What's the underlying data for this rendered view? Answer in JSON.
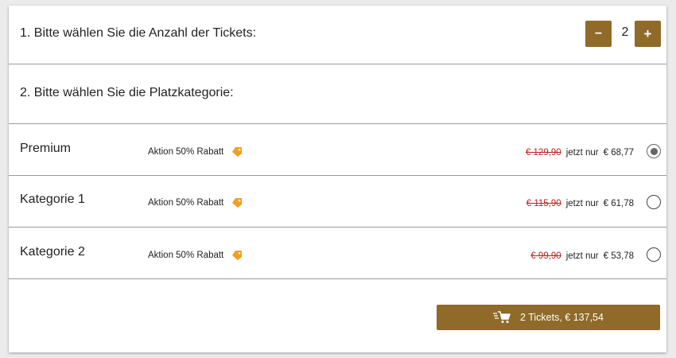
{
  "step1": {
    "label": "1. Bitte wählen Sie die Anzahl der Tickets:",
    "quantity": "2",
    "minus_label": "−",
    "plus_label": "+"
  },
  "step2": {
    "label": "2. Bitte wählen Sie die Platzkategorie:"
  },
  "categories": [
    {
      "name": "Premium",
      "promo": "Aktion 50% Rabatt",
      "old_price": "€ 129,90",
      "now_label": "jetzt nur",
      "new_price": "€ 68,77",
      "selected": true
    },
    {
      "name": "Kategorie 1",
      "promo": "Aktion 50% Rabatt",
      "old_price": "€ 115,90",
      "now_label": "jetzt nur",
      "new_price": "€ 61,78",
      "selected": false
    },
    {
      "name": "Kategorie 2",
      "promo": "Aktion 50% Rabatt",
      "old_price": "€ 99,90",
      "now_label": "jetzt nur",
      "new_price": "€ 53,78",
      "selected": false
    }
  ],
  "cta": {
    "label": "2 Tickets, € 137,54",
    "icon": "cart-icon"
  },
  "colors": {
    "accent": "#8f6a28",
    "tag": "#f0a020",
    "strike": "#b22222",
    "background": "#ebebeb"
  }
}
